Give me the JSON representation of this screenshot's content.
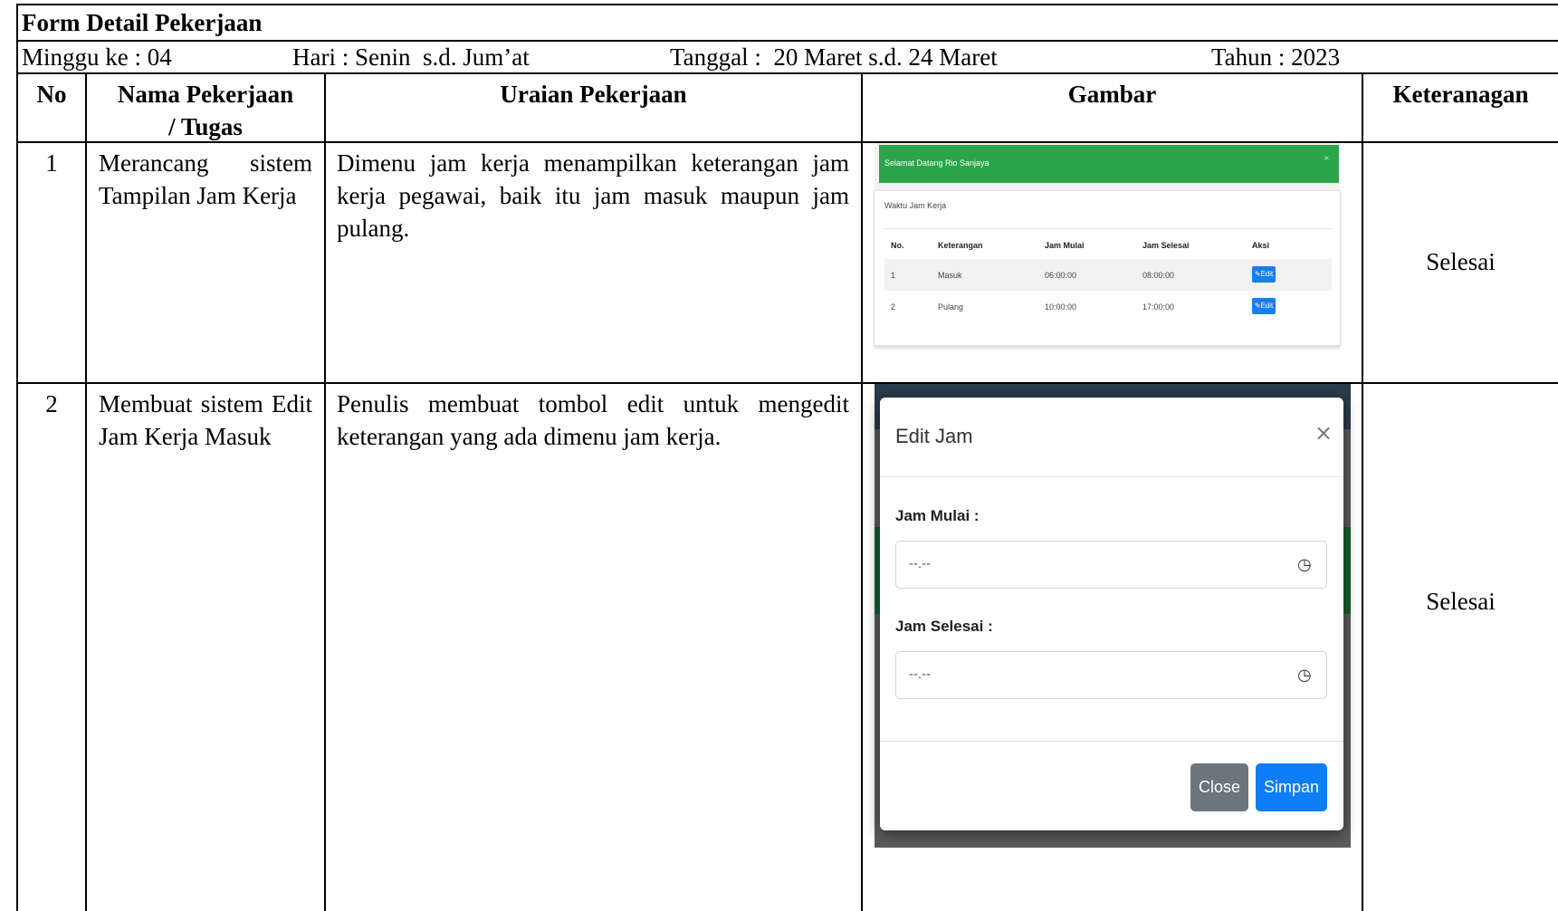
{
  "form": {
    "title": "Form Detail Pekerjaan",
    "week": "Minggu ke : 04",
    "day": "Hari : Senin  s.d. Jum’at",
    "date": "Tanggal :  20 Maret s.d. 24 Maret",
    "year": "Tahun : 2023"
  },
  "columns": {
    "no": "No",
    "name_line1": "Nama Pekerjaan",
    "name_line2": "/ Tugas",
    "desc": "Uraian Pekerjaan",
    "image": "Gambar",
    "note": "Keteranagan"
  },
  "rows": [
    {
      "no": "1",
      "name": "Merancang sistem Tampilan Jam Kerja",
      "desc": "Dimenu jam kerja menampilkan keterangan jam kerja pegawai, baik itu jam masuk maupun jam pulang.",
      "note": "Selesai"
    },
    {
      "no": "2",
      "name": "Membuat sistem Edit Jam Kerja Masuk",
      "desc": "Penulis membuat tombol edit untuk mengedit keterangan yang ada dimenu jam kerja.",
      "note": "Selesai"
    }
  ],
  "screenshot1": {
    "greeting": "Selamat Datang Rio Sanjaya",
    "card_title": "Waktu Jam Kerja",
    "headers": [
      "No.",
      "Keterangan",
      "Jam Mulai",
      "Jam Selesai",
      "Aksi"
    ],
    "rows": [
      {
        "no": "1",
        "ket": "Masuk",
        "mulai": "06:00:00",
        "selesai": "08:00:00",
        "aksi": "Edit"
      },
      {
        "no": "2",
        "ket": "Pulang",
        "mulai": "10:00:00",
        "selesai": "17:00:00",
        "aksi": "Edit"
      }
    ],
    "colors": {
      "header_bar": "#2aa64a",
      "edit_button": "#1a7ef0"
    }
  },
  "screenshot2": {
    "modal_title": "Edit Jam",
    "close_symbol": "×",
    "label_start": "Jam Mulai :",
    "label_end": "Jam Selesai :",
    "time_placeholder": "--.--",
    "close_button": "Close",
    "save_button": "Simpan",
    "colors": {
      "close_button": "#6c757d",
      "save_button": "#0d7ef7"
    }
  }
}
